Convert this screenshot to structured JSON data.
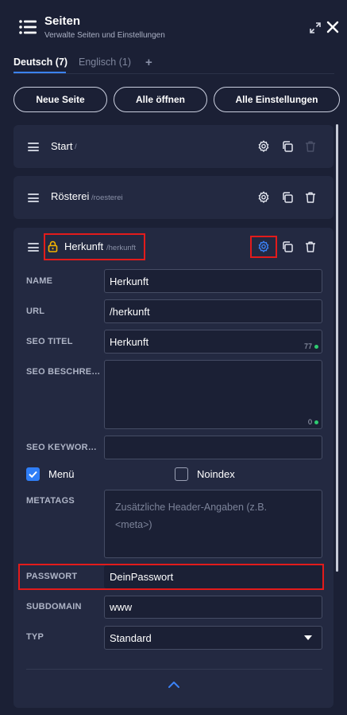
{
  "header": {
    "title": "Seiten",
    "subtitle": "Verwalte Seiten und Einstellungen"
  },
  "tabs": [
    {
      "label": "Deutsch (7)",
      "active": true
    },
    {
      "label": "Englisch (1)",
      "active": false
    }
  ],
  "tab_add_label": "+",
  "actions": {
    "new_page": "Neue Seite",
    "open_all": "Alle öffnen",
    "all_settings": "Alle Einstellungen"
  },
  "pages": [
    {
      "name": "Start",
      "url": "/"
    },
    {
      "name": "Rösterei",
      "url": "/roesterei"
    },
    {
      "name": "Herkunft",
      "url": "/herkunft"
    }
  ],
  "form": {
    "name_label": "NAME",
    "name_value": "Herkunft",
    "url_label": "URL",
    "url_value": "/herkunft",
    "seo_title_label": "SEO TITEL",
    "seo_title_value": "Herkunft",
    "seo_title_count": "77",
    "seo_desc_label": "SEO BESCHRE…",
    "seo_desc_value": "",
    "seo_desc_count": "0",
    "seo_keywords_label": "SEO KEYWOR…",
    "seo_keywords_value": "",
    "menu_label": "Menü",
    "menu_checked": true,
    "noindex_label": "Noindex",
    "noindex_checked": false,
    "metatags_label": "METATAGS",
    "metatags_placeholder": "Zusätzliche Header-Angaben (z.B. <meta>)",
    "password_label": "PASSWORT",
    "password_value": "DeinPasswort",
    "subdomain_label": "SUBDOMAIN",
    "subdomain_value": "www",
    "type_label": "TYP",
    "type_value": "Standard"
  },
  "colors": {
    "accent": "#3b82f6",
    "highlight": "#e31b1b",
    "lock": "#f5b400",
    "counter_dot": "#2ecc71"
  }
}
